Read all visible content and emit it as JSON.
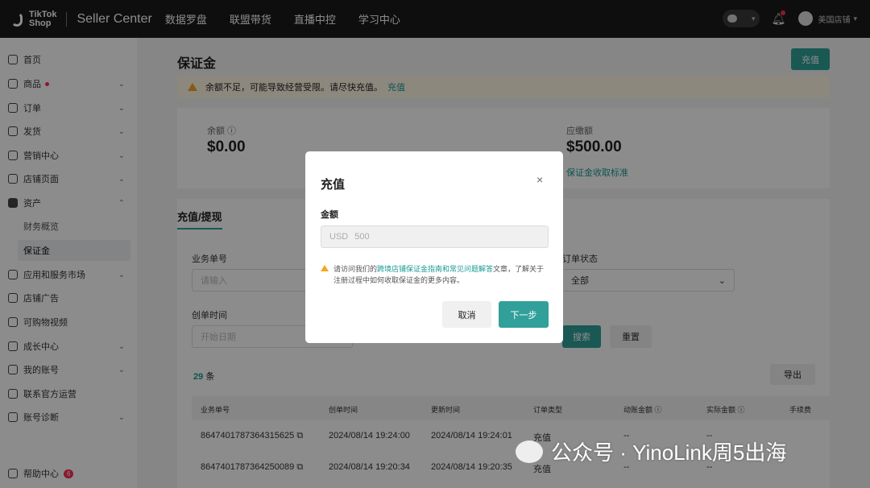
{
  "topbar": {
    "brand_line1": "TikTok",
    "brand_line2": "Shop",
    "product": "Seller Center",
    "nav": [
      "数据罗盘",
      "联盟带货",
      "直播中控",
      "学习中心"
    ],
    "user_name": "美国店铺"
  },
  "sidebar": {
    "items": [
      {
        "label": "首页"
      },
      {
        "label": "商品"
      },
      {
        "label": "订单"
      },
      {
        "label": "发货"
      },
      {
        "label": "营销中心"
      },
      {
        "label": "店铺页面"
      },
      {
        "label": "资产"
      },
      {
        "label": "财务概览"
      },
      {
        "label": "保证金"
      },
      {
        "label": "应用和服务市场"
      },
      {
        "label": "店铺广告"
      },
      {
        "label": "可购物视频"
      },
      {
        "label": "成长中心"
      },
      {
        "label": "我的账号"
      },
      {
        "label": "联系官方运营"
      },
      {
        "label": "账号诊断"
      },
      {
        "label": "帮助中心"
      }
    ],
    "help_badge": "6"
  },
  "main": {
    "title": "保证金",
    "recharge_label": "充值",
    "warning_text": "余额不足，可能导致经营受限。请尽快充值。",
    "warning_link": "充值",
    "balance_label": "余额",
    "balance_value": "$0.00",
    "payable_label": "应缴额",
    "payable_value": "$500.00",
    "standard_link": "保证金收取标准",
    "tab_label": "充值/提现",
    "filter_order_label": "业务单号",
    "filter_order_placeholder": "请输入",
    "filter_status_label": "订单状态",
    "filter_status_value": "全部",
    "filter_time_label": "创单时间",
    "filter_time_placeholder": "开始日期",
    "search_label": "搜索",
    "reset_label": "重置",
    "count_num": "29",
    "count_unit": "条",
    "export_label": "导出",
    "columns": [
      "业务单号",
      "创单时间",
      "更新时间",
      "订单类型",
      "动账金额",
      "实际金额",
      "手续费"
    ],
    "rows": [
      {
        "id": "8647401787364315625",
        "created": "2024/08/14 19:24:00",
        "updated": "2024/08/14 19:24:01",
        "type": "充值",
        "amount": "--",
        "actual": "--"
      },
      {
        "id": "8647401787364250089",
        "created": "2024/08/14 19:20:34",
        "updated": "2024/08/14 19:20:35",
        "type": "充值",
        "amount": "--",
        "actual": "--"
      }
    ]
  },
  "modal": {
    "title": "充值",
    "close_icon": "×",
    "amount_label": "金额",
    "currency": "USD",
    "amount_placeholder": "500",
    "notice_pre": "请访问我们的",
    "notice_link": "跨境店铺保证金指南和常见问题解答",
    "notice_post": "文章，了解关于注册过程中如何收取保证金的更多内容。",
    "cancel_label": "取消",
    "next_label": "下一步"
  },
  "watermark": {
    "text": "公众号 · YinoLink周5出海"
  }
}
